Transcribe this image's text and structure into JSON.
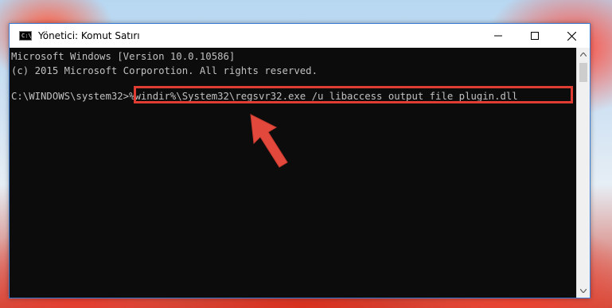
{
  "window": {
    "title": "Yönetici: Komut Satırı",
    "icon_label": "C:\\_",
    "controls": [
      "minimize-icon",
      "maximize-icon",
      "close-icon"
    ]
  },
  "console": {
    "lines": [
      "Microsoft Windows [Version 10.0.10586]",
      "(c) 2015 Microsoft Corporotion. All rights reserved.",
      ""
    ],
    "prompt": "C:\\WINDOWS\\system32>",
    "command": "%windir%\\System32\\regsvr32.exe /u libaccess_output_file_plugin.dll"
  },
  "annotation": {
    "highlight_color": "#e03c31",
    "pointer": "red-arrow-icon"
  },
  "colors": {
    "console_bg": "#0c0c0c",
    "console_text": "#c0c0c0",
    "window_border": "#3a7bd5"
  }
}
